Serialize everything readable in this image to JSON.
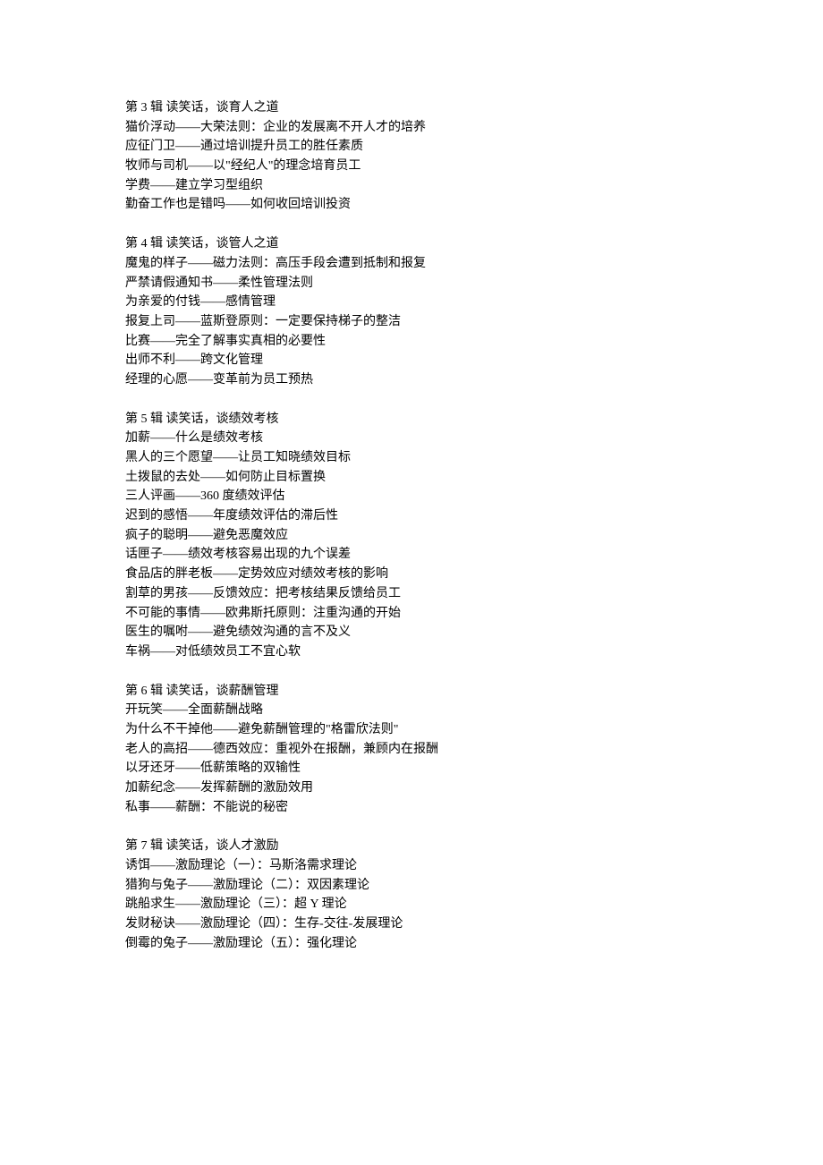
{
  "sections": [
    {
      "title": "第 3 辑  读笑话，谈育人之道",
      "items": [
        "猫价浮动——大荣法则：企业的发展离不开人才的培养",
        "应征门卫——通过培训提升员工的胜任素质",
        "牧师与司机——以\"经纪人\"的理念培育员工",
        "学费——建立学习型组织",
        "勤奋工作也是错吗——如何收回培训投资"
      ]
    },
    {
      "title": "第 4 辑  读笑话，谈管人之道",
      "items": [
        "魔鬼的样子——磁力法则：高压手段会遭到抵制和报复",
        "严禁请假通知书——柔性管理法则",
        "为亲爱的付钱——感情管理",
        "报复上司——蓝斯登原则：一定要保持梯子的整洁",
        "比赛——完全了解事实真相的必要性",
        "出师不利——跨文化管理",
        "经理的心愿——变革前为员工预热"
      ]
    },
    {
      "title": "第 5 辑  读笑话，谈绩效考核",
      "items": [
        "加薪——什么是绩效考核",
        "黑人的三个愿望——让员工知晓绩效目标",
        "土拨鼠的去处——如何防止目标置换",
        "三人评画——360 度绩效评估",
        "迟到的感悟——年度绩效评估的滞后性",
        "疯子的聪明——避免恶魔效应",
        "话匣子——绩效考核容易出现的九个误差",
        "食品店的胖老板——定势效应对绩效考核的影响",
        "割草的男孩——反馈效应：把考核结果反馈给员工",
        "不可能的事情——欧弗斯托原则：注重沟通的开始",
        "医生的嘱咐——避免绩效沟通的言不及义",
        "车祸——对低绩效员工不宜心软"
      ]
    },
    {
      "title": "第 6 辑  读笑话，谈薪酬管理",
      "items": [
        "开玩笑——全面薪酬战略",
        "为什么不干掉他——避免薪酬管理的\"格雷欣法则\"",
        "老人的高招——德西效应：重视外在报酬，兼顾内在报酬",
        "以牙还牙——低薪策略的双输性",
        "加薪纪念——发挥薪酬的激励效用",
        "私事——薪酬：不能说的秘密"
      ]
    },
    {
      "title": "第 7 辑  读笑话，谈人才激励",
      "items": [
        "诱饵——激励理论（一）：马斯洛需求理论",
        "猎狗与兔子——激励理论（二）：双因素理论",
        "跳船求生——激励理论（三）：超 Y 理论",
        "发财秘诀——激励理论（四）：生存-交往-发展理论",
        "倒霉的兔子——激励理论（五）：强化理论"
      ]
    }
  ]
}
